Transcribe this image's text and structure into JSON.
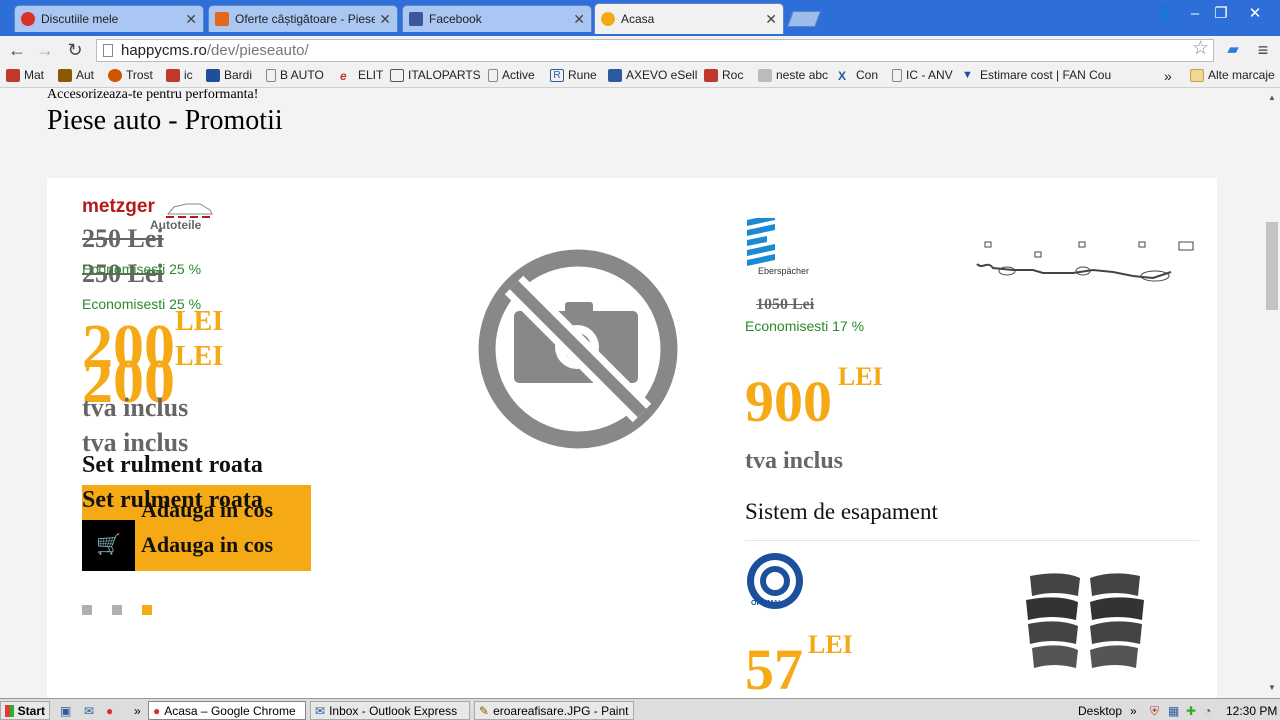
{
  "tabs": [
    {
      "title": "Discutiile mele",
      "color": "#d9302a"
    },
    {
      "title": "Oferte câștigătoare - PieseA",
      "color": "#e2661c"
    },
    {
      "title": "Facebook",
      "color": "#3b5998"
    },
    {
      "title": "Acasa",
      "color": "#f5a914"
    }
  ],
  "address": {
    "host": "happycms.ro",
    "path": "/dev/pieseauto/"
  },
  "bookmarks": [
    {
      "label": "Mat",
      "color": "#c0392b"
    },
    {
      "label": "Aut",
      "color": "#8a5a00"
    },
    {
      "label": "Trost",
      "color": "#d35400"
    },
    {
      "label": "ic",
      "color": "#c0392b"
    },
    {
      "label": "Bardi",
      "color": "#1f4e9c"
    },
    {
      "label": "B AUTO",
      "color": "#888888"
    },
    {
      "label": "ELIT",
      "color": "#c0392b"
    },
    {
      "label": "ITALOPARTS",
      "color": "#555555"
    },
    {
      "label": "Active",
      "color": "#888888"
    },
    {
      "label": "Rune",
      "color": "#2c5aa0"
    },
    {
      "label": "AXEVO eSell",
      "color": "#2c5aa0"
    },
    {
      "label": "Roc",
      "color": "#c0392b"
    },
    {
      "label": "neste abc",
      "color": "#888888"
    },
    {
      "label": "Con",
      "color": "#2c5aa0"
    },
    {
      "label": "IC - ANV",
      "color": "#888888"
    },
    {
      "label": "Estimare cost | FAN Cou",
      "color": "#1f4e9c"
    }
  ],
  "bookmarks_other": "Alte marcaje",
  "page": {
    "tagline": "Accesorizeaza-te pentru performanta!",
    "heading": "Piese auto - Promotii"
  },
  "promo_left": {
    "brand": "metzger",
    "brand_sub": "Autoteile",
    "old_price": "250 Lei",
    "savings": "Economisesti 25 %",
    "price": "200",
    "currency": "LEI",
    "vat": "tva inclus",
    "name": "Set rulment roata",
    "button": "Adauga in cos"
  },
  "promo_right_1": {
    "brand": "Eberspächer",
    "old_price": "1050 Lei",
    "savings": "Economisesti 17 %",
    "price": "900",
    "currency": "LEI",
    "vat": "tva inclus",
    "name": "Sistem de esapament"
  },
  "promo_right_2": {
    "brand": "OPTIMAL",
    "price": "57",
    "currency": "LEI"
  },
  "slider": {
    "count": 3,
    "active_index": 2
  },
  "taskbar": {
    "start": "Start",
    "items": [
      "Acasa – Google Chrome",
      "Inbox - Outlook Express",
      "eroareafisare.JPG - Paint"
    ],
    "desktop": "Desktop",
    "clock": "12:30 PM"
  },
  "colors": {
    "accent": "#f5a914",
    "save_green": "#2b8a2b"
  }
}
